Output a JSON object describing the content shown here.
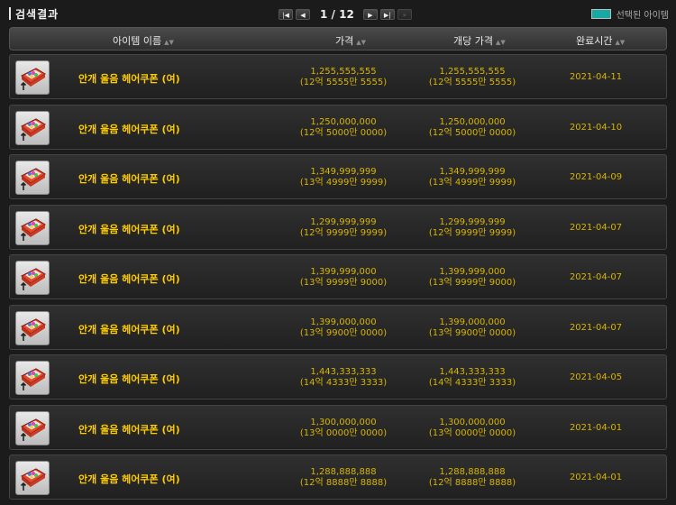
{
  "title": "검색결과",
  "pager": {
    "current": "1",
    "total": "12",
    "text": "1 / 12",
    "first_icon": "first-page-icon",
    "prev_icon": "prev-page-icon",
    "next_icon": "next-page-icon",
    "last_icon": "last-page-icon",
    "skip_icon": "skip-pages-icon"
  },
  "legend": {
    "label": "선택된 아이템",
    "color": "#19a9a4"
  },
  "columns": {
    "item_name": "아이템 이름",
    "price": "가격",
    "unit_price": "개당 가격",
    "end_time": "완료시간"
  },
  "colors": {
    "item_name": "#ffcc00",
    "values": "#d8b400",
    "background": "#1b1b1b"
  },
  "rows": [
    {
      "name": "안개 울음 헤어쿠폰 (여)",
      "price": "1,255,555,555",
      "price_kr": "(12억 5555만 5555)",
      "unit_price": "1,255,555,555",
      "unit_price_kr": "(12억 5555만 5555)",
      "date": "2021-04-11"
    },
    {
      "name": "안개 울음 헤어쿠폰 (여)",
      "price": "1,250,000,000",
      "price_kr": "(12억 5000만 0000)",
      "unit_price": "1,250,000,000",
      "unit_price_kr": "(12억 5000만 0000)",
      "date": "2021-04-10"
    },
    {
      "name": "안개 울음 헤어쿠폰 (여)",
      "price": "1,349,999,999",
      "price_kr": "(13억 4999만 9999)",
      "unit_price": "1,349,999,999",
      "unit_price_kr": "(13억 4999만 9999)",
      "date": "2021-04-09"
    },
    {
      "name": "안개 울음 헤어쿠폰 (여)",
      "price": "1,299,999,999",
      "price_kr": "(12억 9999만 9999)",
      "unit_price": "1,299,999,999",
      "unit_price_kr": "(12억 9999만 9999)",
      "date": "2021-04-07"
    },
    {
      "name": "안개 울음 헤어쿠폰 (여)",
      "price": "1,399,999,000",
      "price_kr": "(13억 9999만 9000)",
      "unit_price": "1,399,999,000",
      "unit_price_kr": "(13억 9999만 9000)",
      "date": "2021-04-07"
    },
    {
      "name": "안개 울음 헤어쿠폰 (여)",
      "price": "1,399,000,000",
      "price_kr": "(13억 9900만 0000)",
      "unit_price": "1,399,000,000",
      "unit_price_kr": "(13억 9900만 0000)",
      "date": "2021-04-07"
    },
    {
      "name": "안개 울음 헤어쿠폰 (여)",
      "price": "1,443,333,333",
      "price_kr": "(14억 4333만 3333)",
      "unit_price": "1,443,333,333",
      "unit_price_kr": "(14억 4333만 3333)",
      "date": "2021-04-05"
    },
    {
      "name": "안개 울음 헤어쿠폰 (여)",
      "price": "1,300,000,000",
      "price_kr": "(13억 0000만 0000)",
      "unit_price": "1,300,000,000",
      "unit_price_kr": "(13억 0000만 0000)",
      "date": "2021-04-01"
    },
    {
      "name": "안개 울음 헤어쿠폰 (여)",
      "price": "1,288,888,888",
      "price_kr": "(12억 8888만 8888)",
      "unit_price": "1,288,888,888",
      "unit_price_kr": "(12억 8888만 8888)",
      "date": "2021-04-01"
    }
  ],
  "row_icon": "hair-coupon-icon"
}
